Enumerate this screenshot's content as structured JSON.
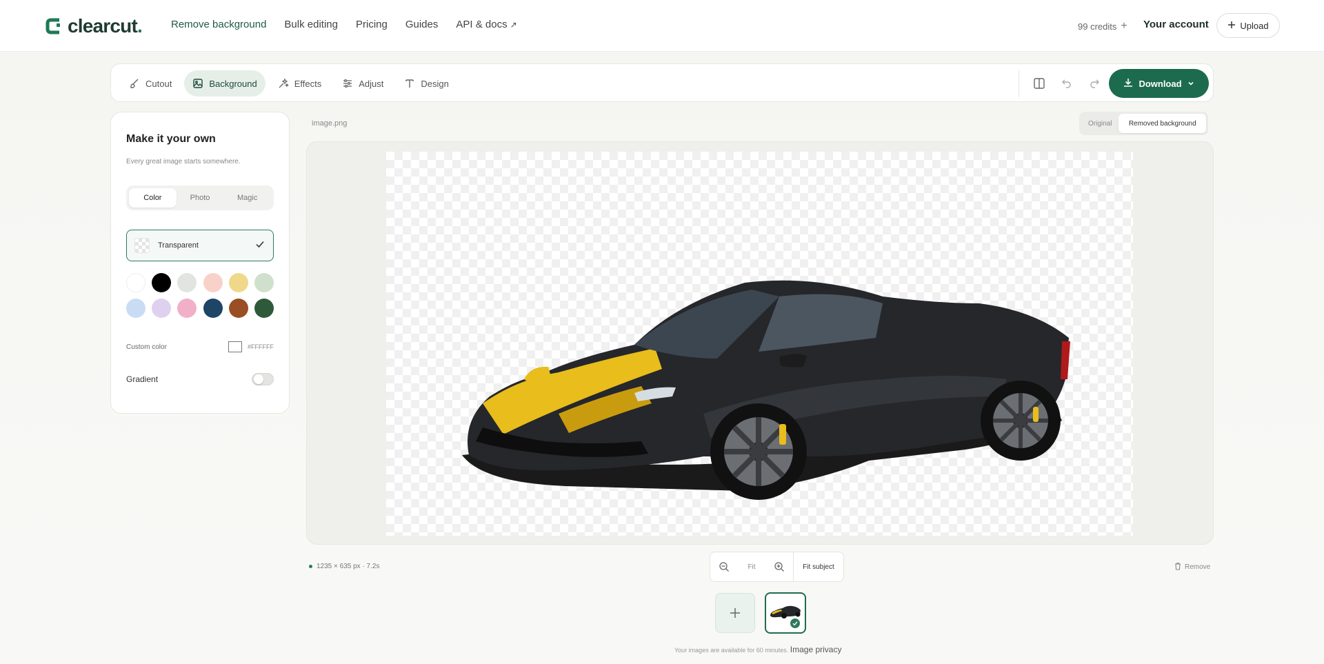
{
  "brand": {
    "name": "clearcut",
    "dot": ".",
    "accent": "#1d6b4f"
  },
  "nav": {
    "items": [
      {
        "label": "Remove background",
        "active": true
      },
      {
        "label": "Bulk editing"
      },
      {
        "label": "Pricing"
      },
      {
        "label": "Guides"
      },
      {
        "label": "API & docs",
        "ext": "↗"
      }
    ],
    "credits": "99 credits",
    "credits_plus": "+",
    "account": "Your account",
    "upload": "Upload"
  },
  "toolbar": {
    "tools": [
      {
        "label": "Cutout",
        "icon": "brush-icon"
      },
      {
        "label": "Background",
        "icon": "image-icon",
        "active": true
      },
      {
        "label": "Effects",
        "icon": "sparkles-icon"
      },
      {
        "label": "Adjust",
        "icon": "sliders-icon"
      },
      {
        "label": "Design",
        "icon": "text-icon"
      }
    ],
    "download": "Download"
  },
  "panel": {
    "title": "Make it your own",
    "subtitle": "Every great image starts somewhere.",
    "tabs": [
      "Color",
      "Photo",
      "Magic"
    ],
    "active_tab": "Color",
    "transparent_label": "Transparent",
    "swatches": [
      [
        "#ffffff",
        "#000000",
        "#e2e4e0",
        "#f8d2c8",
        "#f0d88a",
        "#cfe0cc"
      ],
      [
        "#c9dcf4",
        "#e0d0f0",
        "#f2b0c8",
        "#1e4466",
        "#9a4e24",
        "#2e5a3a"
      ]
    ],
    "custom_color_label": "Custom color",
    "custom_color_value": "#FFFFFF",
    "gradient_label": "Gradient",
    "gradient_on": false
  },
  "canvas": {
    "filename": "image.png",
    "view_original": "Original",
    "view_removed": "Removed background",
    "active_view": "Removed background"
  },
  "bottom": {
    "dimensions": "1235 × 635 px · 7.2s",
    "zoom_fit": "Fit",
    "fit_subject": "Fit subject",
    "remove": "Remove",
    "note": "Your images are available for 60 minutes.",
    "privacy_link": "Image privacy"
  }
}
